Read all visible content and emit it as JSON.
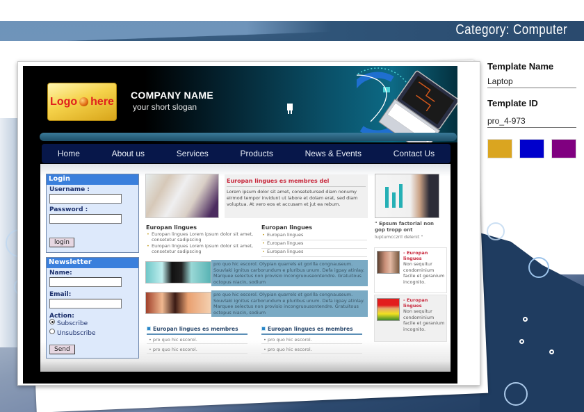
{
  "category": "Category: Computer",
  "info_panel": {
    "template_name_label": "Template Name",
    "template_name_value": "Laptop",
    "template_id_label": "Template ID",
    "template_id_value": "pro_4-973",
    "swatches": [
      {
        "name": "gold",
        "color": "#DAA520"
      },
      {
        "name": "blue",
        "color": "#0000CC"
      },
      {
        "name": "purple",
        "color": "#800080"
      }
    ]
  },
  "site": {
    "logo": {
      "left": "Logo",
      "right": "here"
    },
    "company_name": "COMPANY NAME",
    "slogan": "your short slogan",
    "nav": [
      "Home",
      "About us",
      "Services",
      "Products",
      "News & Events",
      "Contact Us"
    ],
    "login": {
      "title": "Login",
      "username_label": "Username :",
      "username_value": "",
      "password_label": "Password :",
      "password_value": "",
      "button": "login"
    },
    "newsletter": {
      "title": "Newsletter",
      "name_label": "Name:",
      "name_value": "",
      "email_label": "Email:",
      "email_value": "",
      "action_label": "Action:",
      "options": [
        {
          "label": "Subscribe",
          "selected": true
        },
        {
          "label": "Unsubscribe",
          "selected": false
        }
      ],
      "button": "Send"
    },
    "feature": {
      "title": "Europan lingues es membres del",
      "text": "Lorem ipsum dolor sit amet, consetetursed diam nonumy eirmod tempor invidunt ut labore et dolam erat, sed diam voluptua. At vero eos et accusam et jut ea rebum."
    },
    "col_left": {
      "heading": "Europan lingues",
      "items": [
        "Europan lingues Lorem ipsum dolor sit amet, consetetur sadipscing",
        "Europan lingues Lorem ipsum dolor sit amet, consetetur sadipscing"
      ]
    },
    "col_right": {
      "heading": "Europan lingues",
      "items": [
        "Europan lingues",
        "Europan lingues",
        "Europan lingues"
      ]
    },
    "strips": [
      {
        "text": "pro quo hic escorol. Olypian quarrels et gorilla congnauseum. Souvlaki ignitus carborundum e pluribus unum. Defa igpay atinlay. Marquee selectus non provisio incongruouseontendre. Gratuitous octopus niacin, sodium"
      },
      {
        "text": "pro quo hic escorol. Olypian quarrels et gorilla congnauseum. Souvlaki ignitus carborundum e pluribus unum. Defa igpay atinlay. Marquee selectus non provisio incongruousontendre. Gratuitous octopus niacin, sodium"
      }
    ],
    "lists": [
      {
        "heading": "Europan lingues es membres",
        "items": [
          "pro quo hic escorol.",
          "pro quo hic escorol."
        ]
      },
      {
        "heading": "Europan lingues es membres",
        "items": [
          "pro quo hic escorol.",
          "pro quo hic escorol."
        ]
      }
    ],
    "quote": {
      "bold": "\" Epsum factorial non gop tropp ont",
      "normal": "luptumcczril delenit \""
    },
    "testimonials": [
      {
        "title": "- Europan lingues",
        "text": "Non sequitur condominium facile et geranium incognito."
      },
      {
        "title": "- Europan lingues",
        "text": "Non sequitur condominium facile et geranium incognito."
      }
    ]
  }
}
